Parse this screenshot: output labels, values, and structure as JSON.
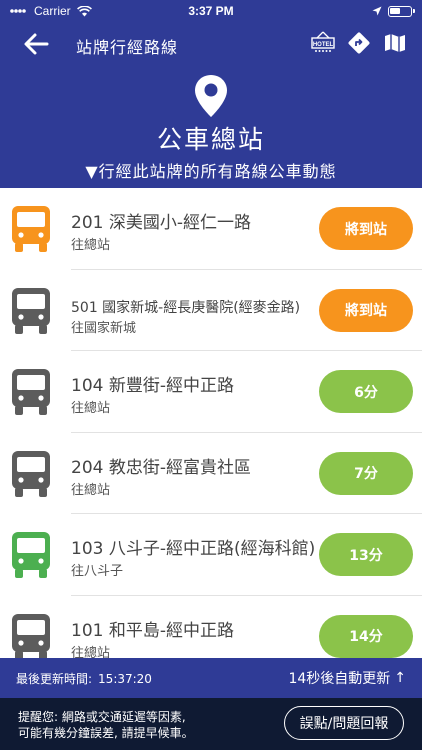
{
  "status_bar": {
    "carrier": "Carrier",
    "time": "3:37 PM"
  },
  "nav": {
    "title": "站牌行經路線",
    "icons": [
      "back-arrow-icon",
      "hotel-icon",
      "directions-icon",
      "map-icon"
    ],
    "hotel_label": "HOTEL"
  },
  "stop": {
    "name": "公車總站",
    "subtitle": "▼行經此站牌的所有路線公車動態"
  },
  "routes": [
    {
      "route": "201 深美國小-經仁一路",
      "dest": "往總站",
      "eta": "將到站",
      "bus_color": "#f7941d",
      "eta_color": "#f7941d"
    },
    {
      "route": "501 國家新城-經長庚醫院(經麥金路)",
      "dest": "往國家新城",
      "eta": "將到站",
      "bus_color": "#5c5c5c",
      "eta_color": "#f7941d"
    },
    {
      "route": "104 新豐街-經中正路",
      "dest": "往總站",
      "eta": "6分",
      "bus_color": "#5c5c5c",
      "eta_color": "#8bc34a"
    },
    {
      "route": "204 教忠街-經富貴社區",
      "dest": "往總站",
      "eta": "7分",
      "bus_color": "#5c5c5c",
      "eta_color": "#8bc34a"
    },
    {
      "route": "103 八斗子-經中正路(經海科館)",
      "dest": "往八斗子",
      "eta": "13分",
      "bus_color": "#4caf50",
      "eta_color": "#8bc34a"
    },
    {
      "route": "101 和平島-經中正路",
      "dest": "往總站",
      "eta": "14分",
      "bus_color": "#5c5c5c",
      "eta_color": "#8bc34a"
    }
  ],
  "update_bar": {
    "last_label": "最後更新時間:",
    "last_time": "15:37:20",
    "auto_refresh": "14秒後自動更新",
    "auto_arrow": "↑"
  },
  "footer": {
    "note_line1": "提醒您: 網路或交通延遲等因素,",
    "note_line2": "可能有幾分鐘誤差, 請提早候車。",
    "report_button": "誤點/問題回報"
  },
  "colors": {
    "primary": "#2f3b96",
    "footer": "#0f1a33",
    "orange": "#f7941d",
    "green": "#8bc34a"
  }
}
